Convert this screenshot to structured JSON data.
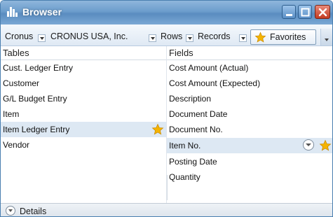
{
  "window": {
    "title": "Browser",
    "icon": "bar-chart-icon"
  },
  "toolbar": {
    "company_short": "Cronus",
    "company": "CRONUS USA, Inc.",
    "rows": "Rows",
    "records": "Records",
    "favorites": "Favorites"
  },
  "tables": {
    "header": "Tables",
    "items": [
      {
        "label": "Cust. Ledger Entry"
      },
      {
        "label": "Customer"
      },
      {
        "label": "G/L Budget Entry"
      },
      {
        "label": "Item"
      },
      {
        "label": "Item Ledger Entry"
      },
      {
        "label": "Vendor"
      }
    ],
    "selected_index": 4
  },
  "fields": {
    "header": "Fields",
    "items": [
      {
        "label": "Cost Amount (Actual)"
      },
      {
        "label": "Cost Amount (Expected)"
      },
      {
        "label": "Description"
      },
      {
        "label": "Document Date"
      },
      {
        "label": "Document No."
      },
      {
        "label": "Item No."
      },
      {
        "label": "Posting Date"
      },
      {
        "label": "Quantity"
      }
    ],
    "selected_index": 5
  },
  "details": {
    "label": "Details"
  },
  "colors": {
    "titlebar": "#6c9dcc",
    "selection": "#dde8f3",
    "star": "#f5b400"
  }
}
